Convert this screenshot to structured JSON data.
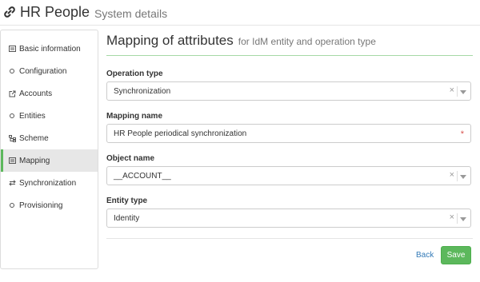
{
  "header": {
    "title": "HR People",
    "subtitle": "System details"
  },
  "sidebar": {
    "items": [
      {
        "label": "Basic information",
        "icon": "list-icon"
      },
      {
        "label": "Configuration",
        "icon": "circle-icon"
      },
      {
        "label": "Accounts",
        "icon": "external-link-icon"
      },
      {
        "label": "Entities",
        "icon": "circle-icon"
      },
      {
        "label": "Scheme",
        "icon": "tree-icon"
      },
      {
        "label": "Mapping",
        "icon": "list-icon",
        "active": true
      },
      {
        "label": "Synchronization",
        "icon": "transfer-icon"
      },
      {
        "label": "Provisioning",
        "icon": "circle-icon"
      }
    ]
  },
  "panel": {
    "title": "Mapping of attributes",
    "subtitle": "for IdM entity and operation type"
  },
  "form": {
    "operation_type": {
      "label": "Operation type",
      "value": "Synchronization"
    },
    "mapping_name": {
      "label": "Mapping name",
      "value": "HR People periodical synchronization",
      "required_mark": "*"
    },
    "object_name": {
      "label": "Object name",
      "value": "__ACCOUNT__"
    },
    "entity_type": {
      "label": "Entity type",
      "value": "Identity"
    },
    "clear_glyph": "×"
  },
  "actions": {
    "back_label": "Back",
    "save_label": "Save"
  },
  "colors": {
    "accent_green": "#5cb85c",
    "link_blue": "#337ab7",
    "required_red": "#d9534f"
  }
}
